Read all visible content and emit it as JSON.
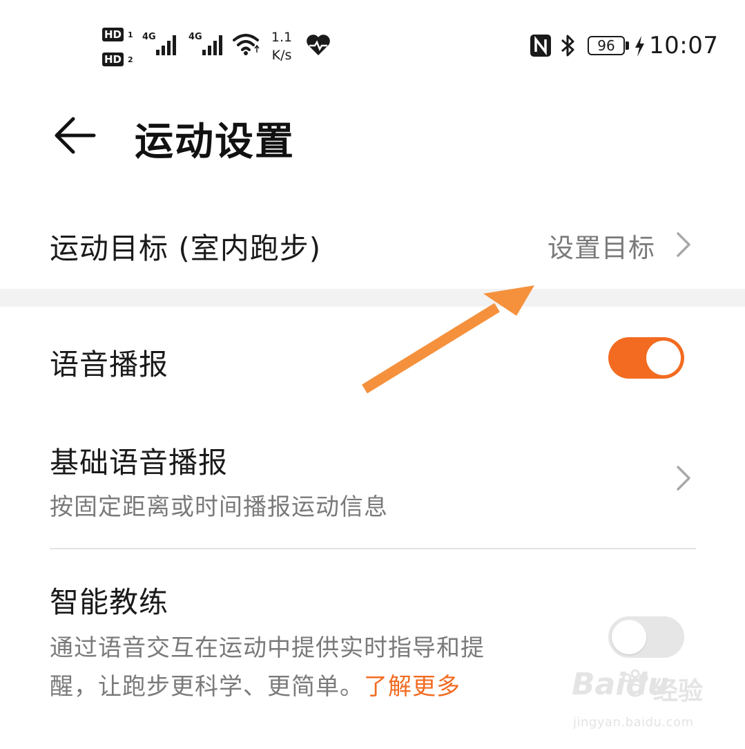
{
  "status_bar": {
    "hd1": "HD",
    "hd1_sub": "1",
    "hd2": "HD",
    "hd2_sub": "2",
    "sig1_label": "4G",
    "sig2_label": "4G",
    "speed_value": "1.1",
    "speed_unit": "K/s",
    "battery": "96",
    "time": "10:07",
    "icons": [
      "signal-icon",
      "wifi-icon",
      "health-heart-icon",
      "nfc-icon",
      "bluetooth-icon",
      "battery-icon",
      "charging-icon"
    ]
  },
  "header": {
    "title": "运动设置",
    "back_icon": "back-arrow-icon"
  },
  "settings": {
    "goal": {
      "label": "运动目标 (室内跑步)",
      "value": "设置目标"
    },
    "voice": {
      "label": "语音播报",
      "enabled": true
    },
    "basic_voice": {
      "label": "基础语音播报",
      "description": "按固定距离或时间播报运动信息"
    },
    "coach": {
      "label": "智能教练",
      "description_line1": "通过语音交互在运动中提供实时指导和提",
      "description_line2": "醒，让跑步更科学、更简单。",
      "learn_more": "了解更多",
      "enabled": false
    }
  },
  "colors": {
    "accent": "#f26b21",
    "arrow_annotation": "#f5913d",
    "toggle_off": "#e6e6e6",
    "secondary_text": "#7a7a7a"
  },
  "watermark": {
    "brand": "Baidu",
    "product": "经验",
    "url": "jingyan.baidu.com"
  }
}
